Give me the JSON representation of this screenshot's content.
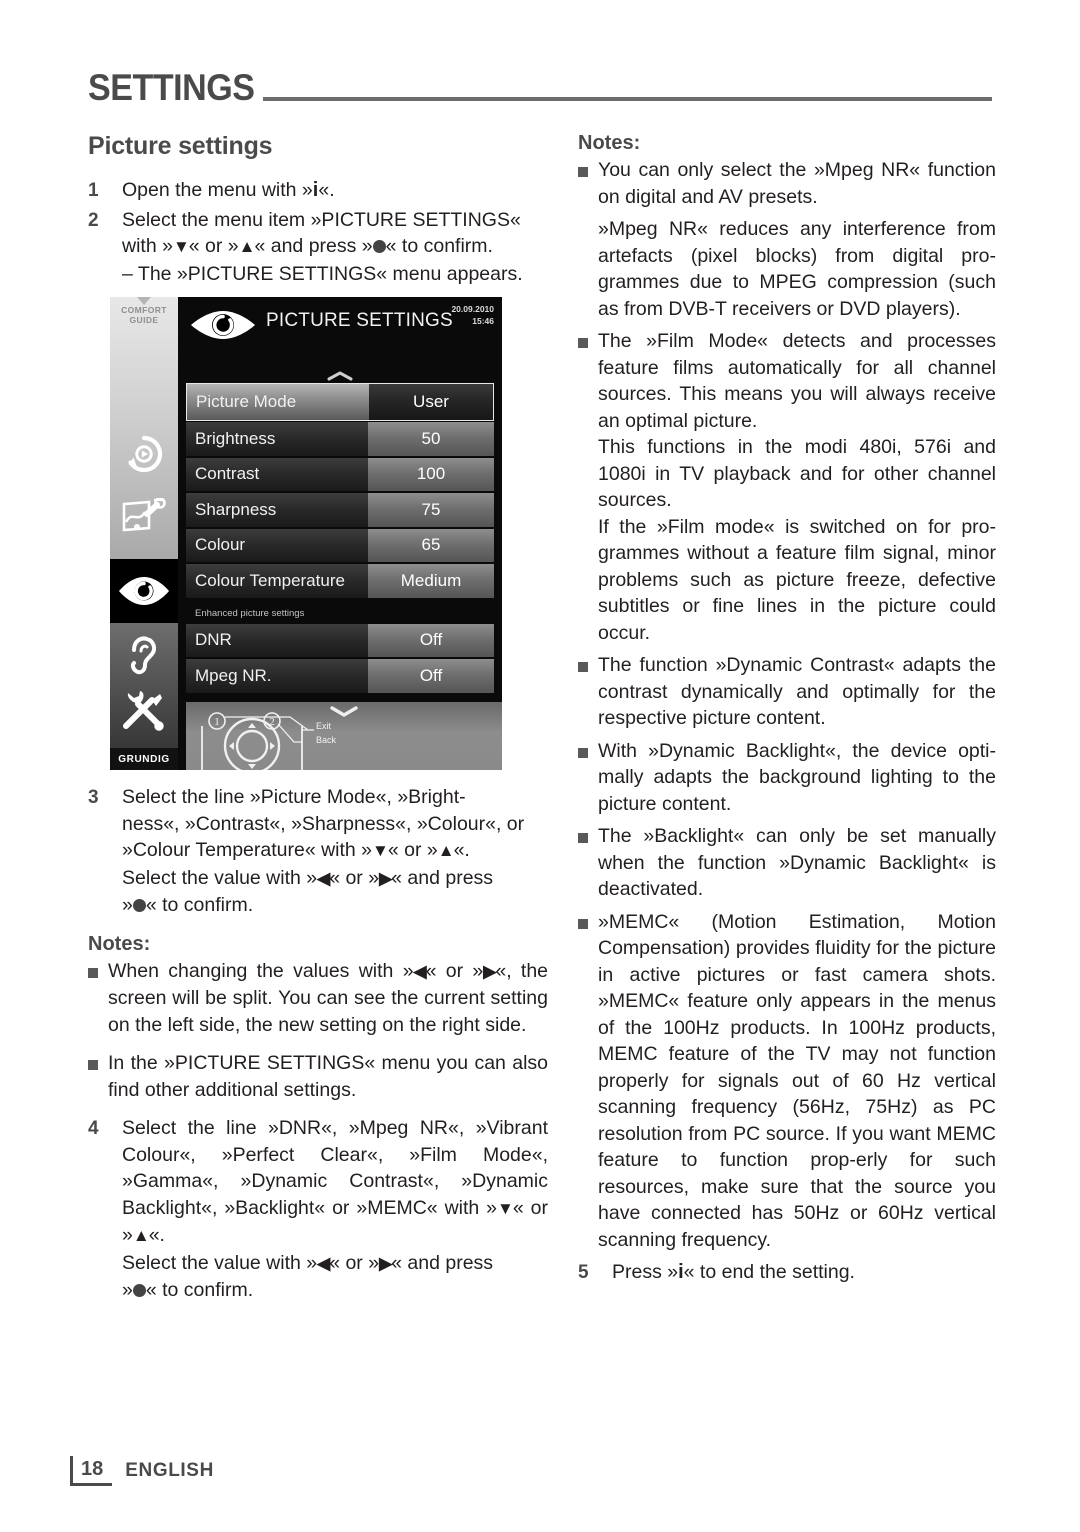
{
  "header": {
    "title": "SETTINGS"
  },
  "left_column": {
    "section_title": "Picture settings",
    "step1": {
      "num": "1",
      "text_a": "Open the menu with »",
      "key": "i",
      "text_b": "«."
    },
    "step2": {
      "num": "2",
      "line1": "Select the menu item »PICTURE SETTINGS«",
      "line2_a": "with »",
      "line2_b": "« or »",
      "line2_c": "« and press »",
      "line2_d": "« to confirm.",
      "line3": "– The »PICTURE SETTINGS« menu appears."
    },
    "step3": {
      "num": "3",
      "line1": "Select the line »Picture Mode«, »Bright-",
      "line2": "ness«, »Contrast«, »Sharpness«, »Colour«, or",
      "line3_a": "»Colour Temperature« with »",
      "line3_b": "« or »",
      "line3_c": "«.",
      "line4_a": "Select the value with »",
      "line4_b": "« or »",
      "line4_c": "« and press",
      "line5_a": "»",
      "line5_b": "« to confirm."
    },
    "notes_title": "Notes:",
    "note1": {
      "a": "When changing the values with »",
      "b": "« or",
      "c": "»",
      "d": "«, the screen will be split. You can see the current setting on the left side, the new setting on the right side."
    },
    "note2": "In the »PICTURE SETTINGS« menu you can also find other additional settings.",
    "step4": {
      "num": "4",
      "line1": "Select the line »DNR«, »Mpeg NR«, »Vibrant Colour«, »Perfect Clear«, »Film Mode«, »Gamma«, »Dynamic Contrast«, »Dynamic Backlight«, »Backlight« or »MEMC« with »",
      "line2": "« or »",
      "line3": "«.",
      "line4_a": "Select the value with »",
      "line4_b": "« or »",
      "line4_c": "« and press",
      "line5_a": "»",
      "line5_b": "« to confirm."
    }
  },
  "tv_menu": {
    "rail_caption_line1": "COMFORT",
    "rail_caption_line2": "GUIDE",
    "brand": "GRUNDIG",
    "title": "PICTURE SETTINGS",
    "date": "20.09.2010",
    "time": "15:46",
    "subheading": "Enhanced picture settings",
    "rows": [
      {
        "label": "Picture Mode",
        "value": "User",
        "selected": true
      },
      {
        "label": "Brightness",
        "value": "50",
        "selected": false
      },
      {
        "label": "Contrast",
        "value": "100",
        "selected": false
      },
      {
        "label": "Sharpness",
        "value": "75",
        "selected": false
      },
      {
        "label": "Colour",
        "value": "65",
        "selected": false
      },
      {
        "label": "Colour Temperature",
        "value": "Medium",
        "selected": false
      }
    ],
    "rows_enhanced": [
      {
        "label": "DNR",
        "value": "Off",
        "selected": false
      },
      {
        "label": "Mpeg NR.",
        "value": "Off",
        "selected": false
      }
    ],
    "pad": {
      "badge1": "1",
      "badge2": "2",
      "exit_label": "Exit",
      "back_label": "Back"
    }
  },
  "right_column": {
    "notes_title": "Notes:",
    "note1": "You can only select the »Mpeg NR« function on digital and AV presets.",
    "note1b": "»Mpeg NR«  reduces any interference from artefacts (pixel blocks) from digital pro-grammes due to MPEG compression (such as from DVB-T receivers or DVD players).",
    "note2": "The »Film Mode« detects and processes feature films automatically for all channel sources. This means you will always receive an optimal picture.",
    "note2b": "This functions in the modi 480i, 576i and 1080i in TV playback and for other channel sources.",
    "note2c": "If the »Film mode« is switched on for pro-grammes without a feature film signal, minor problems such as picture freeze, defective subtitles or fine lines in the picture could occur.",
    "note3": "The function »Dynamic Contrast« adapts the contrast dynamically and optimally for the respective picture content.",
    "note4": "With »Dynamic Backlight«, the device opti-mally adapts the background lighting to the picture content.",
    "note5": "The »Backlight« can only be set manually when the function »Dynamic Backlight« is deactivated.",
    "note6": "»MEMC« (Motion Estimation, Motion Compensation) provides fluidity for the picture in active pictures or fast camera shots. »MEMC« feature only appears in the menus of the 100Hz products. In 100Hz products, MEMC feature of the TV may not function properly for signals out of 60 Hz vertical scanning frequency (56Hz, 75Hz) as PC resolution from PC source. If you want MEMC feature to function prop-erly for such resources, make sure that the source you have connected has 50Hz or 60Hz vertical scanning frequency.",
    "step5": {
      "num": "5",
      "a": "Press »",
      "key": "i",
      "b": "« to end the setting."
    }
  },
  "footer": {
    "page_number": "18",
    "language": "ENGLISH"
  },
  "colors": {
    "text": "#231f20",
    "heading": "#4a4a4a",
    "rule": "#6d6d6d",
    "bullet": "#595959"
  }
}
